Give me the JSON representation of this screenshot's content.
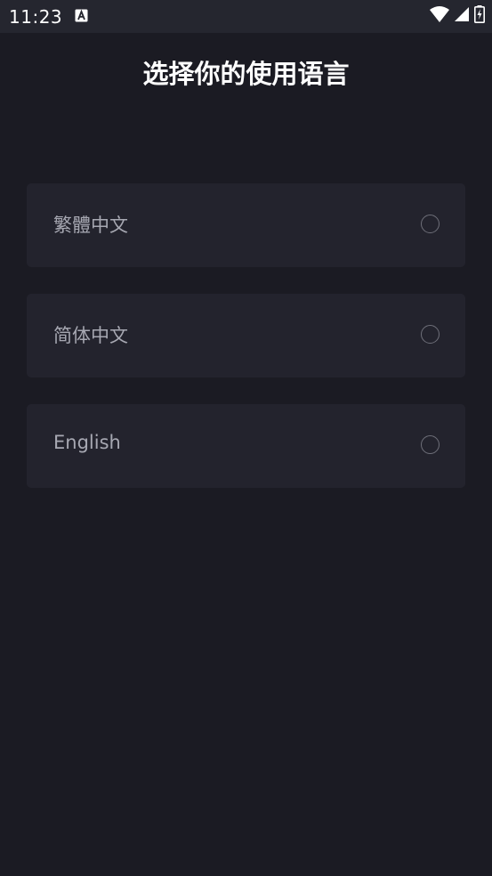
{
  "status_bar": {
    "time": "11:23",
    "notification_icon": "a-text-icon",
    "icons": [
      "wifi-icon",
      "signal-icon",
      "battery-icon"
    ]
  },
  "page": {
    "title": "选择你的使用语言"
  },
  "languages": [
    {
      "label": "繁體中文",
      "selected": false
    },
    {
      "label": "简体中文",
      "selected": false
    },
    {
      "label": "English",
      "selected": false
    }
  ],
  "colors": {
    "background": "#1b1b23",
    "card": "#23232d",
    "status_bar": "#25262f",
    "label_text": "#a7a8b2",
    "radio_border": "#6e6f79"
  }
}
